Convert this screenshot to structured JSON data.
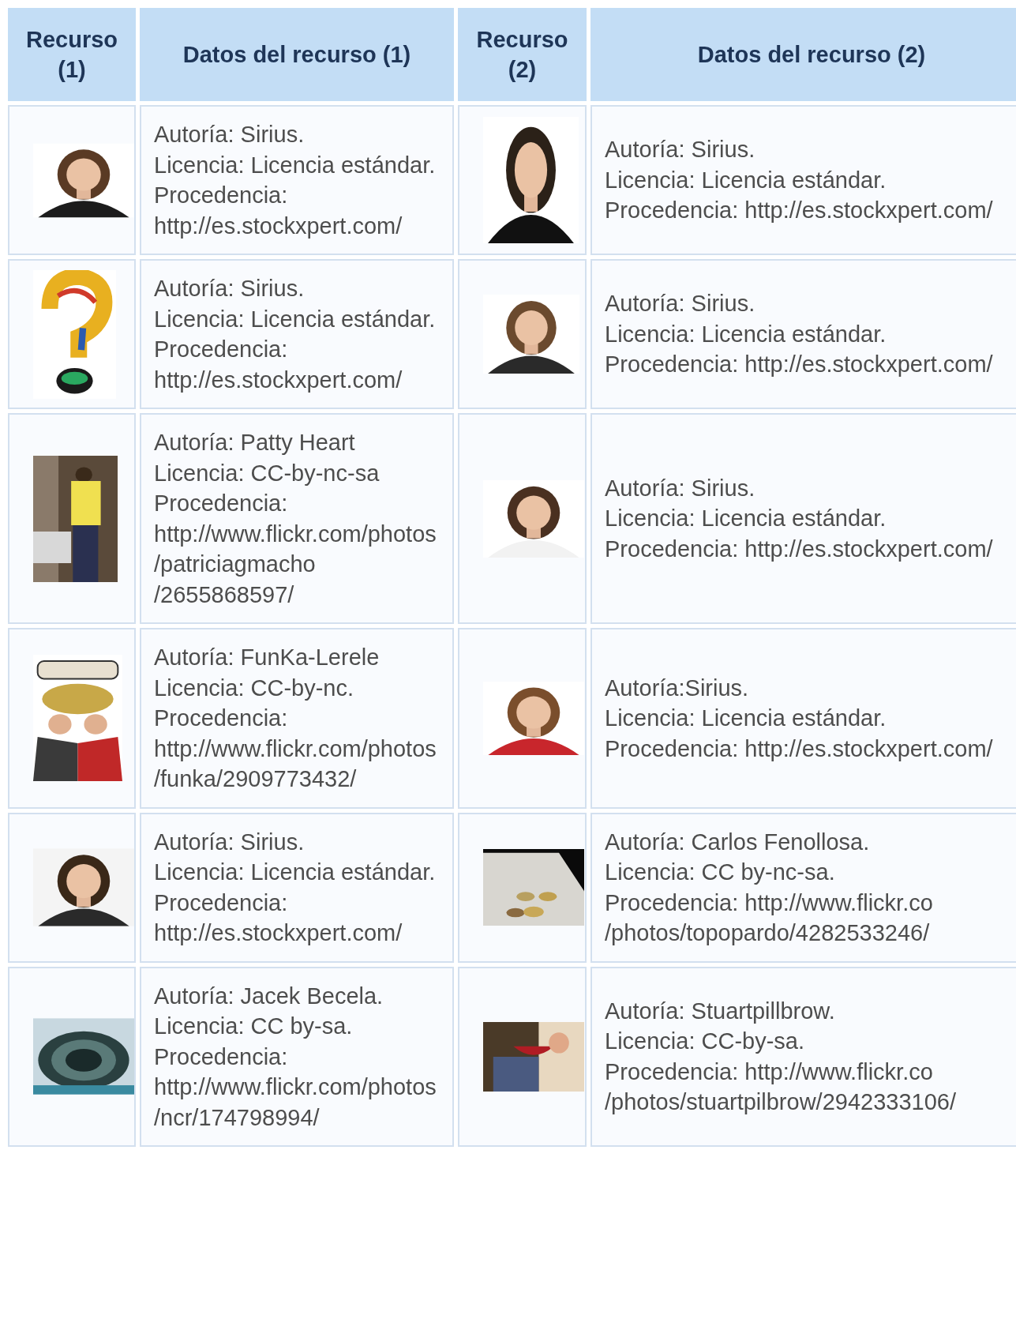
{
  "columns": [
    "Recurso (1)",
    "Datos del recurso (1)",
    "Recurso (2)",
    "Datos del recurso (2)"
  ],
  "rows": [
    {
      "data_1": [
        "Autoría: Sirius.",
        "Licencia: Licencia estándar.",
        "Procedencia: http://es.stockxpert.com/"
      ],
      "data_2": [
        "Autoría: Sirius.",
        "Licencia: Licencia estándar.",
        "Procedencia: http://es.stockxpert.com/"
      ]
    },
    {
      "data_1": [
        "Autoría: Sirius.",
        "Licencia: Licencia estándar.",
        "Procedencia: http://es.stockxpert.com/"
      ],
      "data_2": [
        "Autoría: Sirius.",
        "Licencia: Licencia estándar.",
        "Procedencia: http://es.stockxpert.com/"
      ]
    },
    {
      "data_1": [
        "Autoría: Patty Heart",
        "Licencia: CC-by-nc-sa",
        "Procedencia: http://www.flickr.com/photos/patriciagmacho/2655868597/"
      ],
      "data_2": [
        "Autoría: Sirius.",
        "Licencia: Licencia estándar.",
        "Procedencia: http://es.stockxpert.com/"
      ]
    },
    {
      "data_1": [
        "Autoría: FunKa-Lerele",
        "Licencia: CC-by-nc.",
        "Procedencia: http://www.flickr.com/photos/funka/2909773432/"
      ],
      "data_2": [
        "Autoría:Sirius.",
        "Licencia: Licencia estándar.",
        "Procedencia: http://es.stockxpert.com/"
      ]
    },
    {
      "data_1": [
        "Autoría: Sirius.",
        "Licencia: Licencia estándar.",
        "Procedencia: http://es.stockxpert.com/"
      ],
      "data_2": [
        "Autoría: Carlos Fenollosa.",
        "Licencia: CC by-nc-sa.",
        "Procedencia: http://www.flickr.co",
        "/photos/topopardo/4282533246/"
      ]
    },
    {
      "data_1": [
        "Autoría: Jacek Becela.",
        "Licencia: CC by-sa.",
        "Procedencia: http://www.flickr.com/photos/ncr/174798994/"
      ],
      "data_2": [
        "Autoría: Stuartpillbrow.",
        "Licencia: CC-by-sa.",
        "Procedencia: http://www.flickr.co",
        "/photos/stuartpilbrow/2942333106/"
      ]
    }
  ]
}
